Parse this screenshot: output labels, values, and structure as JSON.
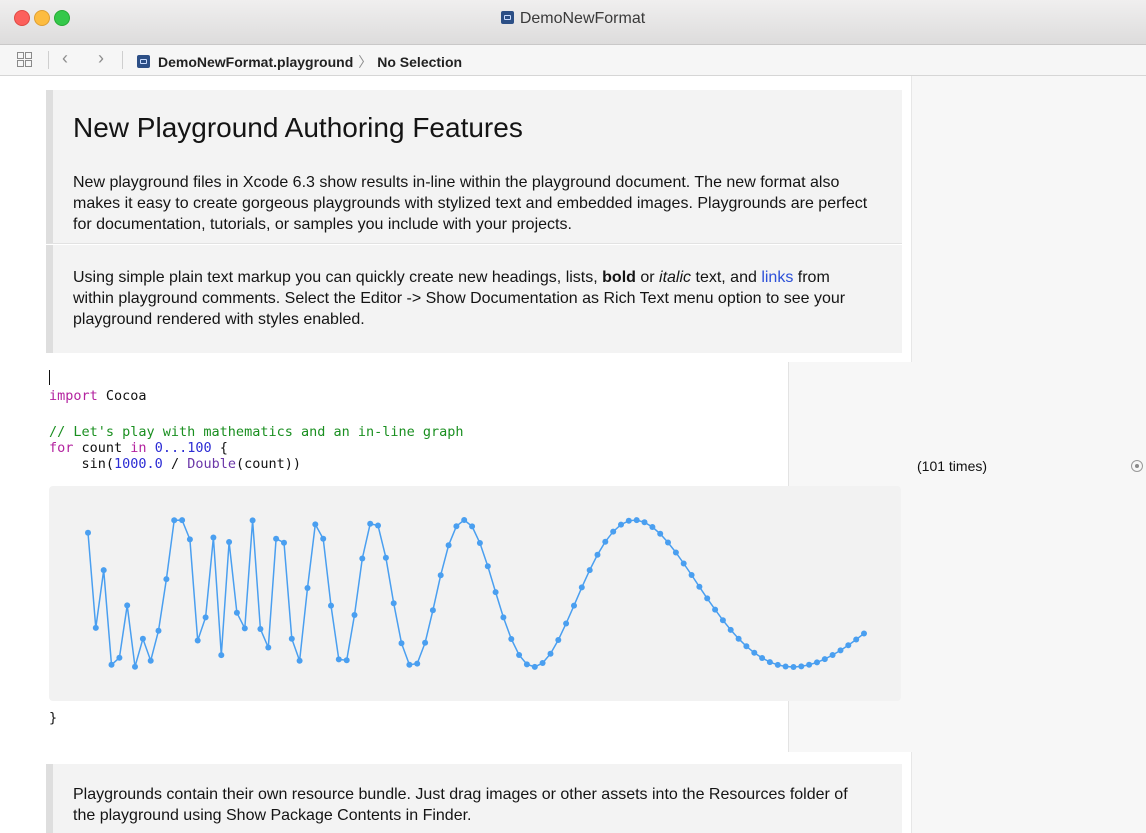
{
  "window": {
    "title": "DemoNewFormat",
    "traffic_lights": {
      "close": "#fc605c",
      "minimize": "#fdbc40",
      "zoom": "#34c84a"
    }
  },
  "navbar": {
    "back_icon": "chevron-left",
    "forward_icon": "chevron-right",
    "breadcrumb": {
      "file": "DemoNewFormat.playground",
      "selection": "No Selection"
    }
  },
  "docs": {
    "heading": "New Playground Authoring Features",
    "para1": "New playground files in Xcode 6.3 show results in-line within the playground document. The new format also makes it easy to create gorgeous playgrounds with stylized text and embedded images. Playgrounds are perfect for documentation, tutorials, or samples you include with your projects.",
    "para2": {
      "t1": "Using simple plain text markup you can quickly create new headings, lists, ",
      "bold": "bold",
      "t2": " or ",
      "italic": "italic",
      "t3": " text, and ",
      "link": "links",
      "t4": " from within playground comments. Select the Editor -> Show Documentation as Rich Text menu option to see your playground rendered with styles enabled."
    },
    "para3": "Playgrounds contain their own resource bundle. Just drag images or other assets into the Resources folder of the playground using Show Package Contents in Finder."
  },
  "code": {
    "import_kw": "import",
    "import_mod": " Cocoa",
    "comment": "// Let's play with mathematics and an in-line graph",
    "for_kw": "for",
    "count_var": " count ",
    "in_kw": "in",
    "range": " 0...100",
    "open_brace": " {",
    "call_fn": "    sin(",
    "call_num": "1000.0",
    "call_div": " / ",
    "call_type": "Double",
    "call_end": "(count))",
    "close_brace": "}"
  },
  "results": {
    "line_result": "(101 times)"
  },
  "chart_data": {
    "type": "line",
    "series": [
      {
        "name": "",
        "expression": "sin(1000.0 / Double(count))",
        "x_from": 0,
        "x_to": 100
      }
    ],
    "color": "#4a9ff0"
  }
}
